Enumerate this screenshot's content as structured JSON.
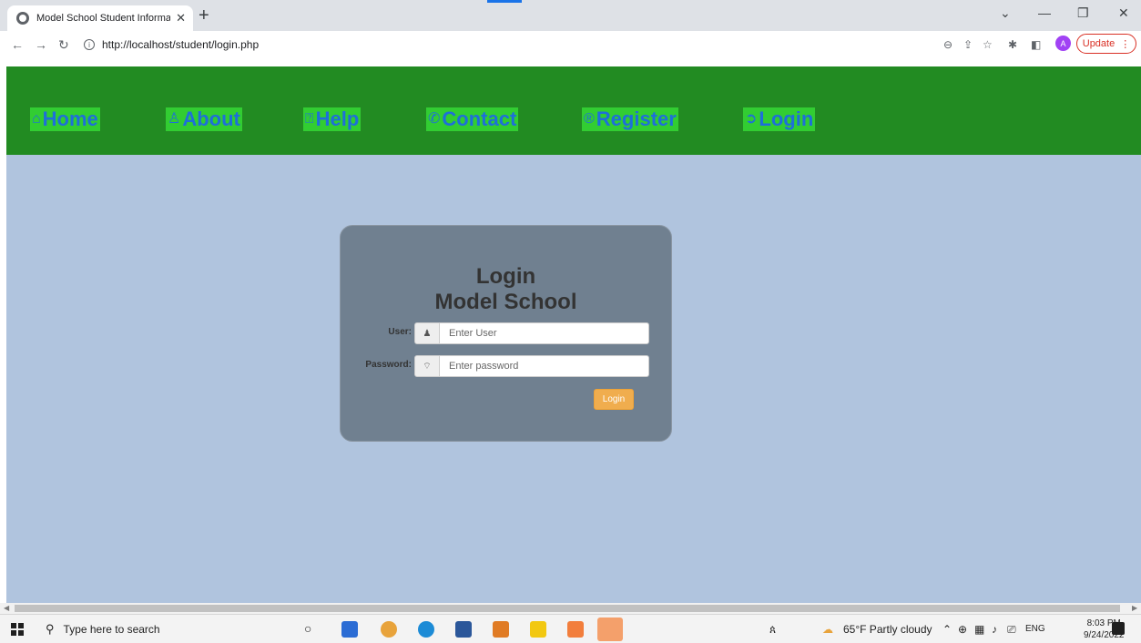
{
  "browser": {
    "tab_title": "Model School Student Informatio",
    "url": "http://localhost/student/login.php",
    "update_label": "Update",
    "profile_initial": "A"
  },
  "nav": {
    "items": [
      {
        "icon": "⌂",
        "label": "Home"
      },
      {
        "icon": "♙",
        "label": "About"
      },
      {
        "icon": "⍰",
        "label": "Help"
      },
      {
        "icon": "✆",
        "label": "Contact"
      },
      {
        "icon": "®",
        "label": "Register"
      },
      {
        "icon": "➲",
        "label": "Login"
      }
    ]
  },
  "login": {
    "title_line1": "Login",
    "title_line2": "Model School",
    "user_label": "User:",
    "user_placeholder": "Enter User",
    "password_label": "Password:",
    "password_placeholder": "Enter password",
    "submit_label": "Login"
  },
  "taskbar": {
    "search_placeholder": "Type here to search",
    "weather": "65°F  Partly cloudy",
    "language": "ENG",
    "time": "8:03 PM",
    "date": "9/24/2022",
    "notification_count": "1"
  },
  "colors": {
    "page_bg": "#b0c4de",
    "navbar_bg": "#228b22",
    "nav_link_bg": "#32cd32",
    "nav_link_text": "#1e6fd9",
    "card_bg": "#708090",
    "button_bg": "#f0ad4e"
  }
}
